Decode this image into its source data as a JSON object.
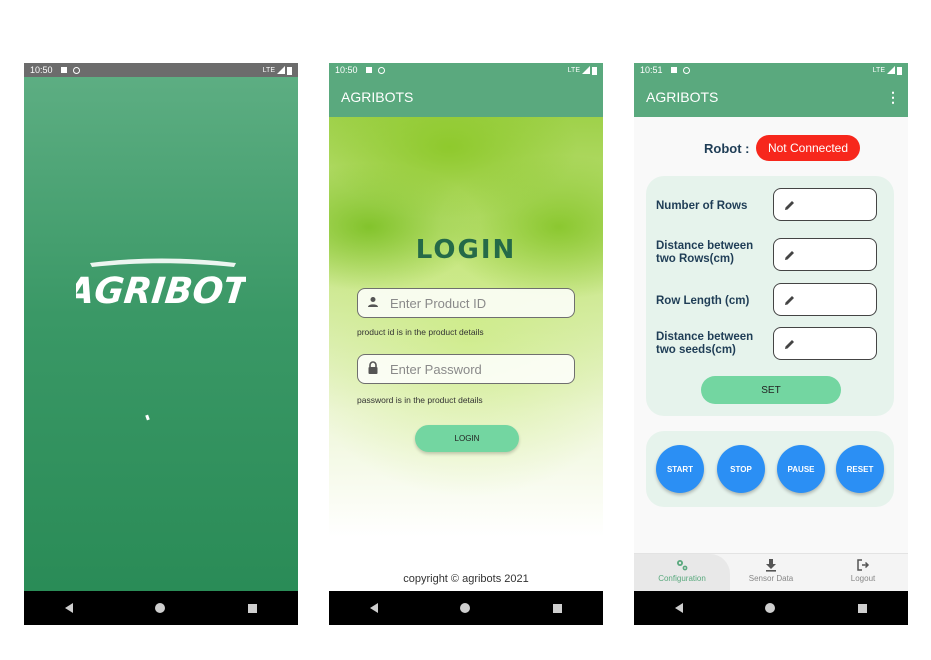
{
  "splash": {
    "time": "10:50",
    "network": "LTE",
    "logo_text": "AGRIBOT"
  },
  "login": {
    "time": "10:50",
    "network": "LTE",
    "app_title": "AGRIBOTS",
    "heading": "LOGIN",
    "product_id_placeholder": "Enter Product ID",
    "product_id_hint": "product id is in the product details",
    "password_placeholder": "Enter Password",
    "password_hint": "password is in the product details",
    "login_button": "LOGIN",
    "copyright": "copyright © agribots 2021"
  },
  "config": {
    "time": "10:51",
    "network": "LTE",
    "app_title": "AGRIBOTS",
    "overflow_icon": "more-vert-icon",
    "robot_label": "Robot :",
    "robot_status": "Not Connected",
    "status_color": "#f7271c",
    "rows": [
      {
        "label": "Number of Rows"
      },
      {
        "label": "Distance between two Rows(cm)"
      },
      {
        "label": "Row Length (cm)"
      },
      {
        "label": "Distance between two seeds(cm)"
      }
    ],
    "set_button": "SET",
    "controls": [
      "START",
      "STOP",
      "PAUSE",
      "RESET"
    ],
    "bottom_nav": [
      {
        "label": "Configuration",
        "icon": "settings-icon",
        "active": true
      },
      {
        "label": "Sensor Data",
        "icon": "download-icon",
        "active": false
      },
      {
        "label": "Logout",
        "icon": "logout-icon",
        "active": false
      }
    ]
  },
  "colors": {
    "primary": "#5aa97e",
    "accent_button": "#73d6a1",
    "control_button": "#2b8ff4",
    "heading_green": "#256a48",
    "label_navy": "#1f3d56"
  }
}
